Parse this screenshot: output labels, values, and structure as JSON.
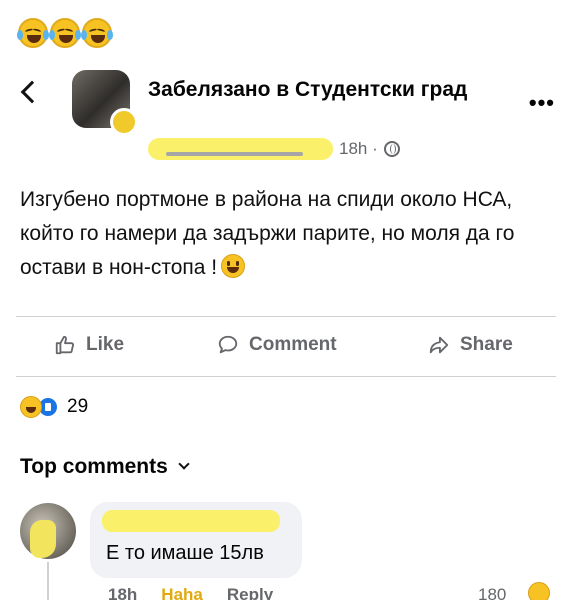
{
  "header": {
    "group_title": "Забелязано в Студентски град",
    "time": "18h ·"
  },
  "post": {
    "text": "Изгубено портмоне в района  на спиди около НСА, който го намери да задържи парите, но моля да го остави в нон-стопа !"
  },
  "actions": {
    "like": "Like",
    "comment": "Comment",
    "share": "Share"
  },
  "reactions": {
    "count": "29"
  },
  "comments": {
    "heading": "Top comments",
    "first": {
      "text": "Е то имаше 15лв",
      "time": "18h",
      "reaction_label": "Haha",
      "reply_label": "Reply",
      "reaction_count": "180"
    }
  },
  "colors": {
    "meta_gray": "#65676b",
    "redaction_yellow": "#faf06a",
    "like_blue": "#1b74e4",
    "haha_yellow": "#e2a90f"
  },
  "icons": [
    "laughing-crying-emoji-icon",
    "back-chevron-icon",
    "more-options-icon",
    "globe-icon",
    "smiling-emoji-icon",
    "like-thumb-icon",
    "comment-bubble-icon",
    "share-arrow-icon",
    "haha-reaction-icon",
    "like-reaction-icon",
    "chevron-down-icon"
  ]
}
